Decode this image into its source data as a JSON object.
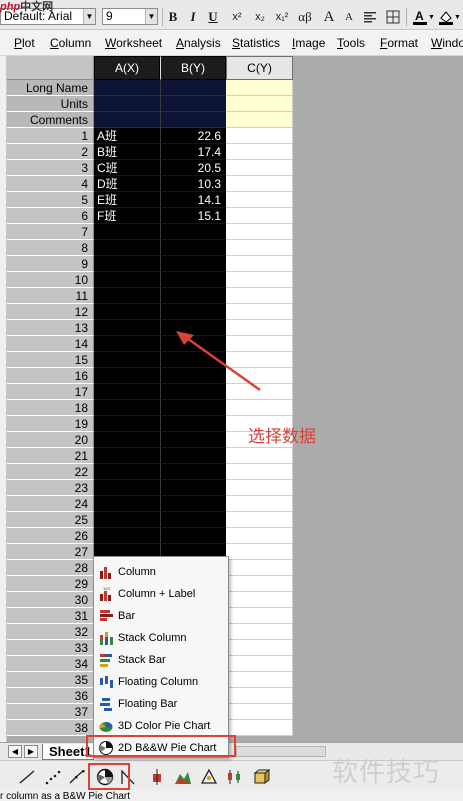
{
  "watermark_top": {
    "part1": "php",
    "part2": "中文网"
  },
  "format_toolbar": {
    "font_name": "Default: Arial",
    "font_size": "9",
    "bold": "B",
    "italic": "I",
    "underline": "U",
    "superscript": "x²",
    "subscript": "x₂",
    "sup_sub": "x₁²",
    "greek": "αβ",
    "grow_font": "A",
    "shrink_font": "A"
  },
  "menubar": [
    {
      "label": "Plot",
      "key": "P"
    },
    {
      "label": "Column",
      "key": "C"
    },
    {
      "label": "Worksheet",
      "key": "W"
    },
    {
      "label": "Analysis",
      "key": "A"
    },
    {
      "label": "Statistics",
      "key": "S"
    },
    {
      "label": "Image",
      "key": "I"
    },
    {
      "label": "Tools",
      "key": "T"
    },
    {
      "label": "Format",
      "key": "F"
    },
    {
      "label": "Windo",
      "key": "W"
    }
  ],
  "worksheet": {
    "columns": [
      "A(X)",
      "B(Y)",
      "C(Y)"
    ],
    "meta_rows": [
      "Long Name",
      "Units",
      "Comments"
    ],
    "row_numbers": [
      "1",
      "2",
      "3",
      "4",
      "5",
      "6",
      "7",
      "8",
      "9",
      "10",
      "11",
      "12",
      "13",
      "14",
      "15",
      "16",
      "17",
      "18",
      "19",
      "20",
      "21",
      "22",
      "23",
      "24",
      "25",
      "26",
      "27",
      "28",
      "29",
      "30",
      "31",
      "32",
      "33",
      "34",
      "35",
      "36",
      "37",
      "38"
    ],
    "data": [
      {
        "a": "A班",
        "b": "22.6"
      },
      {
        "a": "B班",
        "b": "17.4"
      },
      {
        "a": "C班",
        "b": "20.5"
      },
      {
        "a": "D班",
        "b": "10.3"
      },
      {
        "a": "E班",
        "b": "14.1"
      },
      {
        "a": "F班",
        "b": "15.1"
      }
    ]
  },
  "annotation": {
    "text": "选择数据",
    "color": "#d9423a"
  },
  "popup_menu": [
    {
      "label": "Column",
      "icon": "column-chart-icon"
    },
    {
      "label": "Column + Label",
      "icon": "column-label-chart-icon"
    },
    {
      "label": "Bar",
      "icon": "bar-chart-icon"
    },
    {
      "label": "Stack Column",
      "icon": "stack-column-icon"
    },
    {
      "label": "Stack Bar",
      "icon": "stack-bar-icon"
    },
    {
      "label": "Floating Column",
      "icon": "floating-column-icon"
    },
    {
      "label": "Floating Bar",
      "icon": "floating-bar-icon"
    },
    {
      "label": "3D Color Pie Chart",
      "icon": "3d-pie-icon"
    },
    {
      "label": "2D B&&W Pie Chart",
      "icon": "2d-bw-pie-icon"
    }
  ],
  "sheet_tab": {
    "label": "Sheet1"
  },
  "watermark_bottom": "软件技巧",
  "status_bar": "r column as a B&W Pie Chart",
  "colors": {
    "accent_red": "#e0403a",
    "selection": "#000000"
  }
}
